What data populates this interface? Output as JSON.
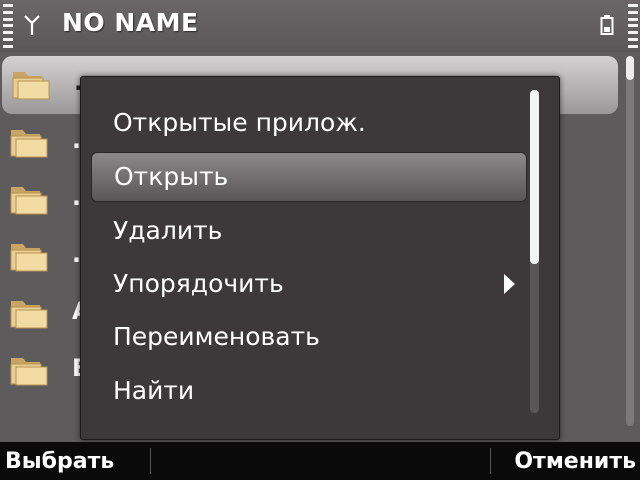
{
  "status_bar": {
    "title": "NO NAME",
    "signal_icon": "antenna-icon",
    "battery_icon": "battery-icon"
  },
  "file_list": {
    "items": [
      {
        "label": "...",
        "icon": "folder-icon",
        "selected": true
      },
      {
        "label": ".",
        "icon": "folder-icon",
        "selected": false
      },
      {
        "label": ".",
        "icon": "folder-icon",
        "selected": false
      },
      {
        "label": ".",
        "icon": "folder-icon",
        "selected": false
      },
      {
        "label": "A",
        "icon": "folder-icon",
        "selected": false
      },
      {
        "label": "B",
        "icon": "folder-icon",
        "selected": false
      }
    ]
  },
  "context_menu": {
    "items": [
      {
        "label": "Открытые прилож.",
        "highlighted": false,
        "submenu": false
      },
      {
        "label": "Открыть",
        "highlighted": true,
        "submenu": false
      },
      {
        "label": "Удалить",
        "highlighted": false,
        "submenu": false
      },
      {
        "label": "Упорядочить",
        "highlighted": false,
        "submenu": true
      },
      {
        "label": "Переименовать",
        "highlighted": false,
        "submenu": false
      },
      {
        "label": "Найти",
        "highlighted": false,
        "submenu": false
      }
    ],
    "submenu_icon": "chevron-right-icon"
  },
  "softkeys": {
    "left_label": "Выбрать",
    "right_label": "Отменить"
  },
  "colors": {
    "background": "#5e5b5c",
    "menu_background": "#3d383a",
    "softkey_bar": "#0a0a0a",
    "text": "#ffffff"
  }
}
